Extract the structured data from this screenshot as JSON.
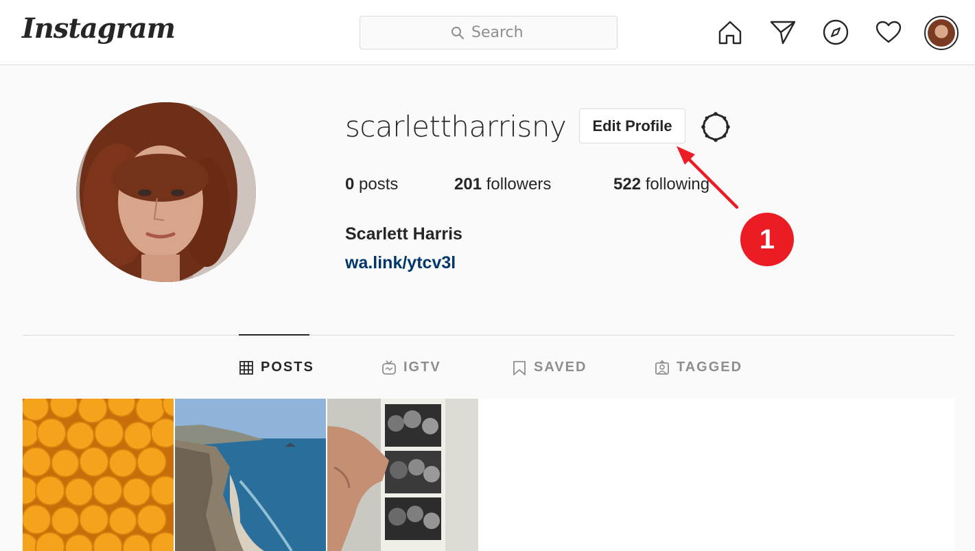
{
  "header": {
    "logo_text": "Instagram",
    "search_placeholder": "Search"
  },
  "profile": {
    "username": "scarlettharrisny",
    "edit_button_label": "Edit Profile",
    "posts_count": "0",
    "posts_label": "posts",
    "followers_count": "201",
    "followers_label": "followers",
    "following_count": "522",
    "following_label": "following",
    "full_name": "Scarlett Harris",
    "bio_link": "wa.link/ytcv3l"
  },
  "annotation": {
    "step_number": "1",
    "color": "#ec1c24"
  },
  "tabs": [
    {
      "label": "POSTS",
      "icon": "grid-icon",
      "active": true
    },
    {
      "label": "IGTV",
      "icon": "igtv-icon",
      "active": false
    },
    {
      "label": "SAVED",
      "icon": "bookmark-icon",
      "active": false
    },
    {
      "label": "TAGGED",
      "icon": "tagged-icon",
      "active": false
    }
  ],
  "posts": [
    {
      "subject": "oranges"
    },
    {
      "subject": "coastal cliffs and ocean"
    },
    {
      "subject": "photo booth strip"
    }
  ],
  "colors": {
    "link": "#00376b",
    "border": "#dbdbdb",
    "text": "#262626",
    "muted": "#8e8e8e"
  }
}
